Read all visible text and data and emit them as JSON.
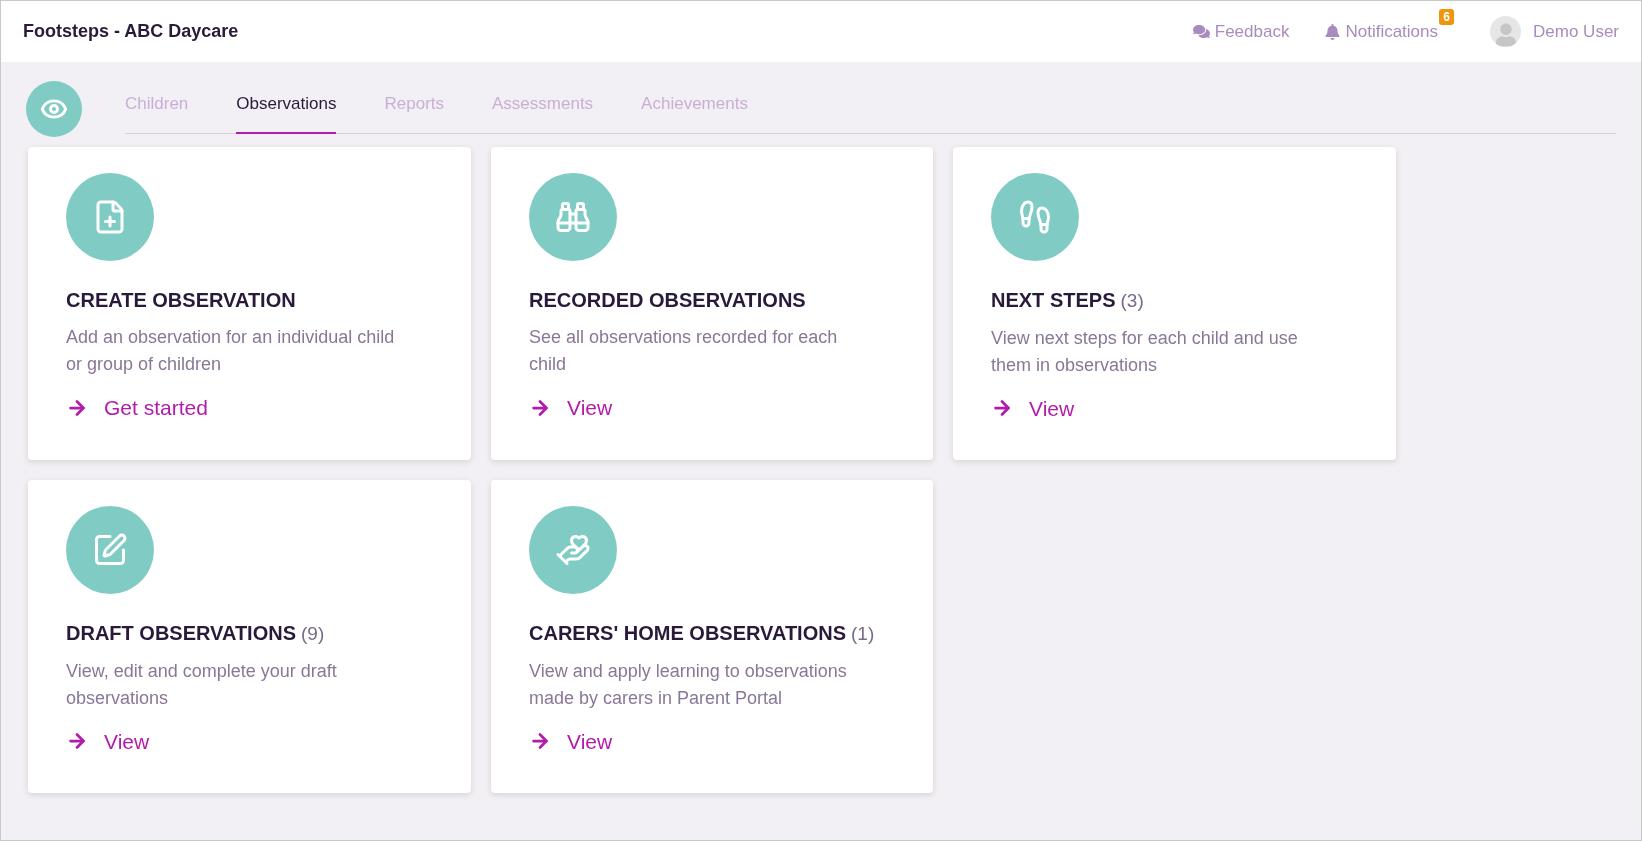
{
  "header": {
    "title": "Footsteps - ABC Daycare",
    "feedback": "Feedback",
    "notifications": {
      "label": "Notifications",
      "badge": "6"
    },
    "user": "Demo User"
  },
  "tabs": [
    {
      "label": "Children",
      "selected": false
    },
    {
      "label": "Observations",
      "selected": true
    },
    {
      "label": "Reports",
      "selected": false
    },
    {
      "label": "Assessments",
      "selected": false
    },
    {
      "label": "Achievements",
      "selected": false
    }
  ],
  "cards": [
    {
      "kind": "create",
      "title": "CREATE OBSERVATION",
      "description": "Add an observation for an individual child or group of children",
      "link": "Get started"
    },
    {
      "kind": "recorded",
      "title": "RECORDED OBSERVATIONS",
      "description": "See all observations recorded for each child",
      "link": "View"
    },
    {
      "kind": "nextsteps",
      "title": "NEXT STEPS",
      "count": "(3)",
      "description": "View next steps for each child and use them in observations",
      "link": "View"
    },
    {
      "kind": "draft",
      "title": "DRAFT OBSERVATIONS",
      "count": "(9)",
      "description": "View, edit and complete your draft observations",
      "link": "View"
    },
    {
      "kind": "carers",
      "title": "CARERS' HOME OBSERVATIONS",
      "count": "(1)",
      "description": "View and apply learning to observations made by carers in Parent Portal",
      "link": "View"
    }
  ]
}
